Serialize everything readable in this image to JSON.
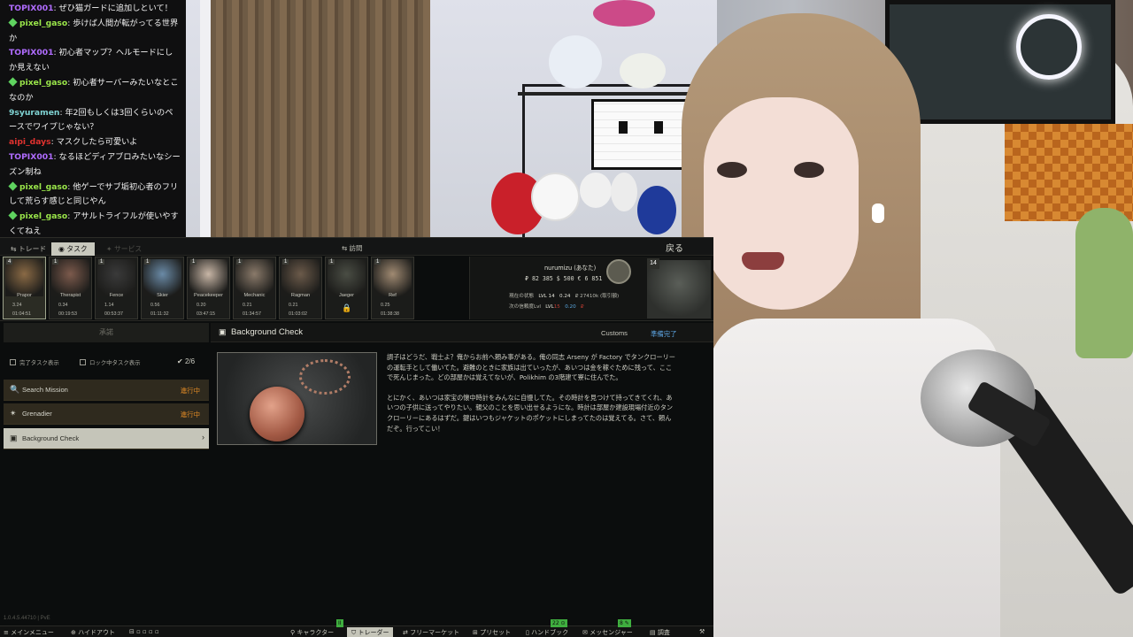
{
  "chat": {
    "lines": [
      {
        "user": "TOPIX001",
        "user_color": "#b06cff",
        "badge": false,
        "text": ": ぜひ猫ガードに追加しといて！"
      },
      {
        "user": "pixel_gaso",
        "user_color": "#9ae64a",
        "badge": true,
        "text": ": 歩けば人間が転がってる世界か"
      },
      {
        "user": "TOPIX001",
        "user_color": "#b06cff",
        "badge": false,
        "text": ": 初心者マップ？ヘルモードにしか見えない"
      },
      {
        "user": "pixel_gaso",
        "user_color": "#9ae64a",
        "badge": true,
        "text": ": 初心者サーバーみたいなとこなのか"
      },
      {
        "user": "9syuramen",
        "user_color": "#7fd3d3",
        "badge": false,
        "text": ": 年2回もしくは3回くらいのペースでワイプじゃない？"
      },
      {
        "user": "aipi_days",
        "user_color": "#e0322f",
        "badge": false,
        "text": ": マスクしたら可愛いよ"
      },
      {
        "user": "TOPIX001",
        "user_color": "#b06cff",
        "badge": false,
        "text": ": なるほどディアブロみたいなシーズン制ね"
      },
      {
        "user": "pixel_gaso",
        "user_color": "#9ae64a",
        "badge": true,
        "text": ": 他ゲーでサブ垢初心者のフリして荒らす感じと同じやん"
      },
      {
        "user": "pixel_gaso",
        "user_color": "#9ae64a",
        "badge": true,
        "text": ": アサルトライフルが使いやすくてねえ"
      }
    ]
  },
  "game": {
    "tabs": {
      "trade": "トレード",
      "tasks": "タスク",
      "services": "サービス"
    },
    "visit": "訪問",
    "back": "戻る",
    "traders": [
      {
        "name": "Prapor",
        "lvl": "3.24",
        "time": "01:04:51",
        "badge": "4",
        "selected": true,
        "locked": false,
        "tone": "#8a6a45"
      },
      {
        "name": "Therapist",
        "lvl": "0.34",
        "time": "00:19:53",
        "badge": "1",
        "selected": false,
        "locked": false,
        "tone": "#7c5a4c"
      },
      {
        "name": "Fence",
        "lvl": "1.14",
        "time": "00:53:37",
        "badge": "1",
        "selected": false,
        "locked": false,
        "tone": "#3a3a3a"
      },
      {
        "name": "Skier",
        "lvl": "0.56",
        "time": "01:11:32",
        "badge": "1",
        "selected": false,
        "locked": false,
        "tone": "#6a8aa6"
      },
      {
        "name": "Peacekeeper",
        "lvl": "0.20",
        "time": "03:47:15",
        "badge": "1",
        "selected": false,
        "locked": false,
        "tone": "#c8b6a6"
      },
      {
        "name": "Mechanic",
        "lvl": "0.21",
        "time": "01:34:57",
        "badge": "1",
        "selected": false,
        "locked": false,
        "tone": "#8a7a6a"
      },
      {
        "name": "Ragman",
        "lvl": "0.21",
        "time": "01:03:02",
        "badge": "1",
        "selected": false,
        "locked": false,
        "tone": "#6b5a4a"
      },
      {
        "name": "Jaeger",
        "lvl": "",
        "time": "",
        "badge": "1",
        "selected": false,
        "locked": true,
        "tone": "#4a4d44"
      },
      {
        "name": "Ref",
        "lvl": "0.25",
        "time": "01:38:38",
        "badge": "1",
        "selected": false,
        "locked": false,
        "tone": "#a08a72"
      }
    ],
    "player": {
      "name": "nurumizu (あなた)",
      "money": "₽ 82 385   $ 500   € 6 851",
      "status_label": "現在の状態",
      "next_label": "次の信頼度Lvl",
      "lvl_a": "LVL 14",
      "standing_a": "0.24",
      "rub_a": "₽ 27410k (取引額)",
      "lvl_b": "LVL",
      "standing_b": "0.20",
      "rub_b": "₽",
      "level": "14"
    },
    "left": {
      "accept": "承諾",
      "filter_complete": "完了タスク表示",
      "filter_locked": "ロック中タスク表示",
      "count": "2/6",
      "tasks": [
        {
          "icon": "search-icon",
          "glyph": "🔍",
          "label": "Search Mission",
          "status": "進行中"
        },
        {
          "icon": "grenade-icon",
          "glyph": "✴",
          "label": "Grenadier",
          "status": "進行中"
        },
        {
          "icon": "bookmark-icon",
          "glyph": "▣",
          "label": "Background Check",
          "status": ""
        }
      ]
    },
    "detail": {
      "title": "Background Check",
      "location": "Customs",
      "state": "準備完了",
      "paragraphs": [
        "調子はどうだ、戦士よ？俺からお前へ頼み事がある。俺の同志 Arseny が Factory でタンクローリーの運転手として働いてた。避難のときに家族は出ていったが、あいつは金を稼ぐために残って、ここで死んじまった。どの部屋かは覚えてないが、Polikhim の3階建て寮に住んでた。",
        "とにかく、あいつは家宝の懐中時計をみんなに自慢してた。その時計を見つけて持ってきてくれ、あいつの子供に送ってやりたい。親父のことを思い出せるようにな。時計は部屋か建設現場付近のタンクローリーにあるはずだ。鍵はいつもジャケットのポケットにしまってたのは覚えてる。さて、頼んだぞ。行ってこい！"
      ]
    },
    "version": "1.0.4.5.44710 | PvE",
    "bottom": {
      "main_menu": "メインメニュー",
      "hideout": "ハイドアウト",
      "character": "キャラクター",
      "traders": "トレーダー",
      "flea": "フリーマーケット",
      "presets": "プリセット",
      "handbook": "ハンドブック",
      "messenger": "メッセンジャー",
      "survey": "調査"
    }
  }
}
